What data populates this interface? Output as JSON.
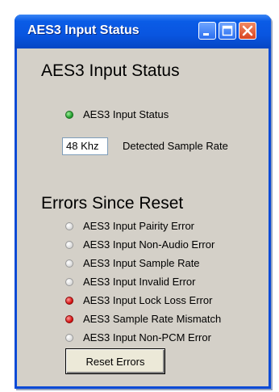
{
  "window": {
    "title": "AES3 Input Status",
    "controls": {
      "minimize": "minimize-icon",
      "maximize": "maximize-icon",
      "close": "close-icon"
    }
  },
  "status_section": {
    "heading": "AES3 Input Status",
    "indicator": {
      "label": "AES3 Input Status",
      "state": "green"
    },
    "sample_rate": {
      "value": "48 Khz",
      "label": "Detected Sample Rate"
    }
  },
  "errors_section": {
    "heading": "Errors Since Reset",
    "items": [
      {
        "label": "AES3 Input Pairity Error",
        "state": "off"
      },
      {
        "label": "AES3 Input Non-Audio Error",
        "state": "off"
      },
      {
        "label": "AES3 Input Sample Rate",
        "state": "off"
      },
      {
        "label": "AES3 Input Invalid Error",
        "state": "off"
      },
      {
        "label": "AES3 Input Lock Loss Error",
        "state": "red"
      },
      {
        "label": "AES3 Sample Rate Mismatch",
        "state": "red"
      },
      {
        "label": "AES3 Input Non-PCM Error",
        "state": "off"
      }
    ],
    "reset_label": "Reset Errors"
  },
  "colors": {
    "active_led": "#1e9a2a",
    "error_led": "#d40f0f",
    "title_bar": "#0955e0",
    "panel": "#d4d0c8"
  }
}
